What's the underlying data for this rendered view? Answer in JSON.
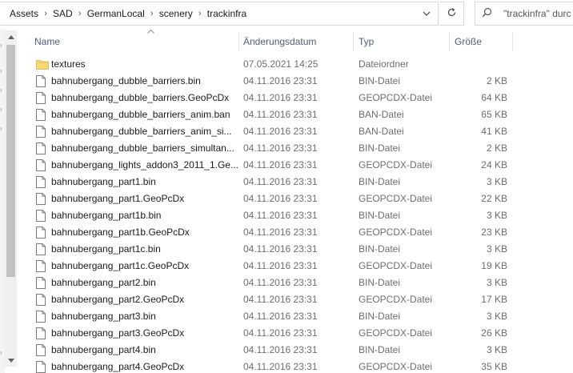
{
  "address_bar": {
    "crumbs": [
      "Assets",
      "SAD",
      "GermanLocal",
      "scenery",
      "trackinfra"
    ]
  },
  "search": {
    "placeholder": "\"trackinfra\" durc"
  },
  "columns": {
    "name": "Name",
    "date": "Änderungsdatum",
    "type": "Typ",
    "size": "Größe"
  },
  "files": [
    {
      "name": "textures",
      "date": "07.05.2021 14:25",
      "type": "Dateiordner",
      "size": "",
      "icon": "folder-icon"
    },
    {
      "name": "bahnubergang_dubble_barriers.bin",
      "date": "04.11.2016 23:31",
      "type": "BIN-Datei",
      "size": "2 KB",
      "icon": "file-icon"
    },
    {
      "name": "bahnubergang_dubble_barriers.GeoPcDx",
      "date": "04.11.2016 23:31",
      "type": "GEOPCDX-Datei",
      "size": "64 KB",
      "icon": "file-icon"
    },
    {
      "name": "bahnubergang_dubble_barriers_anim.ban",
      "date": "04.11.2016 23:31",
      "type": "BAN-Datei",
      "size": "65 KB",
      "icon": "file-icon"
    },
    {
      "name": "bahnubergang_dubble_barriers_anim_si...",
      "date": "04.11.2016 23:31",
      "type": "BAN-Datei",
      "size": "41 KB",
      "icon": "file-icon"
    },
    {
      "name": "bahnubergang_dubble_barriers_simultan...",
      "date": "04.11.2016 23:31",
      "type": "BIN-Datei",
      "size": "2 KB",
      "icon": "file-icon"
    },
    {
      "name": "bahnubergang_lights_addon3_2011_1.Ge...",
      "date": "04.11.2016 23:31",
      "type": "GEOPCDX-Datei",
      "size": "24 KB",
      "icon": "file-icon"
    },
    {
      "name": "bahnubergang_part1.bin",
      "date": "04.11.2016 23:31",
      "type": "BIN-Datei",
      "size": "3 KB",
      "icon": "file-icon"
    },
    {
      "name": "bahnubergang_part1.GeoPcDx",
      "date": "04.11.2016 23:31",
      "type": "GEOPCDX-Datei",
      "size": "22 KB",
      "icon": "file-icon"
    },
    {
      "name": "bahnubergang_part1b.bin",
      "date": "04.11.2016 23:31",
      "type": "BIN-Datei",
      "size": "3 KB",
      "icon": "file-icon"
    },
    {
      "name": "bahnubergang_part1b.GeoPcDx",
      "date": "04.11.2016 23:31",
      "type": "GEOPCDX-Datei",
      "size": "23 KB",
      "icon": "file-icon"
    },
    {
      "name": "bahnubergang_part1c.bin",
      "date": "04.11.2016 23:31",
      "type": "BIN-Datei",
      "size": "3 KB",
      "icon": "file-icon"
    },
    {
      "name": "bahnubergang_part1c.GeoPcDx",
      "date": "04.11.2016 23:31",
      "type": "GEOPCDX-Datei",
      "size": "19 KB",
      "icon": "file-icon"
    },
    {
      "name": "bahnubergang_part2.bin",
      "date": "04.11.2016 23:31",
      "type": "BIN-Datei",
      "size": "3 KB",
      "icon": "file-icon"
    },
    {
      "name": "bahnubergang_part2.GeoPcDx",
      "date": "04.11.2016 23:31",
      "type": "GEOPCDX-Datei",
      "size": "17 KB",
      "icon": "file-icon"
    },
    {
      "name": "bahnubergang_part3.bin",
      "date": "04.11.2016 23:31",
      "type": "BIN-Datei",
      "size": "3 KB",
      "icon": "file-icon"
    },
    {
      "name": "bahnubergang_part3.GeoPcDx",
      "date": "04.11.2016 23:31",
      "type": "GEOPCDX-Datei",
      "size": "26 KB",
      "icon": "file-icon"
    },
    {
      "name": "bahnubergang_part4.bin",
      "date": "04.11.2016 23:31",
      "type": "BIN-Datei",
      "size": "3 KB",
      "icon": "file-icon"
    },
    {
      "name": "bahnubergang_part4.GeoPcDx",
      "date": "04.11.2016 23:31",
      "type": "GEOPCDX-Datei",
      "size": "35 KB",
      "icon": "file-icon"
    }
  ],
  "colors": {
    "header_text": "#4c607a",
    "folder": "#f8d775",
    "meta_text": "#6d6d6d"
  }
}
